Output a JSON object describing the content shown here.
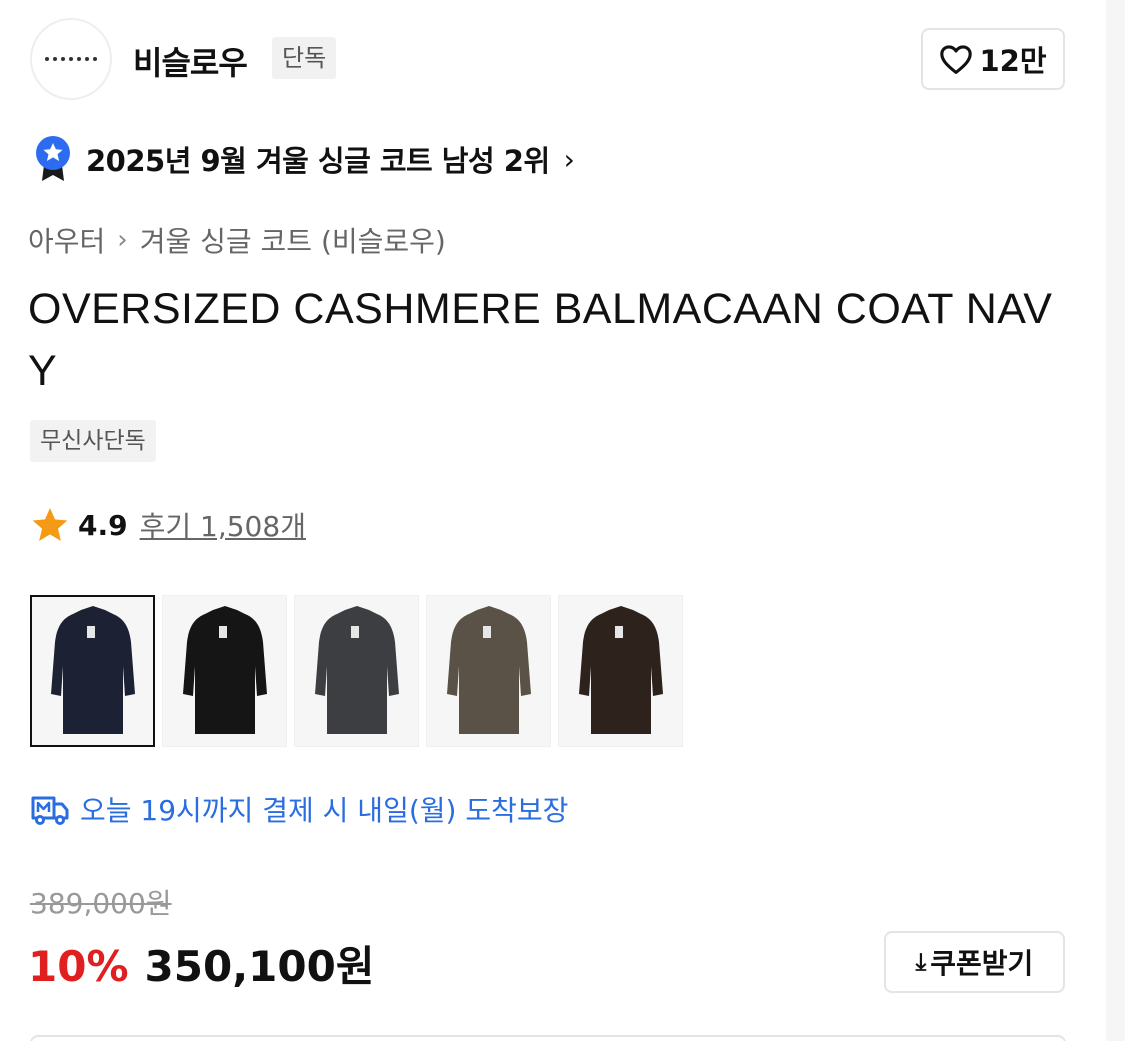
{
  "brand": {
    "name": "비슬로우",
    "badge": "단독",
    "like_count": "12만"
  },
  "ranking": {
    "text": "2025년 9월 겨울 싱글 코트 남성 2위",
    "chevron": "›"
  },
  "breadcrumb": {
    "category": "아우터",
    "separator": "›",
    "subcategory": "겨울 싱글 코트 (비슬로우)"
  },
  "product": {
    "title": "OVERSIZED CASHMERE BALMACAAN COAT NAVY",
    "exclusive_badge": "무신사단독"
  },
  "rating": {
    "value": "4.9",
    "reviews": "후기 1,508개"
  },
  "color_options": [
    {
      "name": "navy",
      "color": "#1c2233",
      "selected": true
    },
    {
      "name": "black",
      "color": "#151515",
      "selected": false
    },
    {
      "name": "charcoal",
      "color": "#3d3e42",
      "selected": false
    },
    {
      "name": "khaki",
      "color": "#5a5246",
      "selected": false
    },
    {
      "name": "brown",
      "color": "#2e221d",
      "selected": false
    }
  ],
  "delivery": {
    "text": "오늘 19시까지 결제 시 내일(월) 도착보장",
    "color": "#2a6de0"
  },
  "price": {
    "original": "389,000원",
    "discount": "10%",
    "sale": "350,100원",
    "discount_color": "#e02020"
  },
  "coupon": {
    "icon": "⤓",
    "label": "쿠폰받기"
  }
}
